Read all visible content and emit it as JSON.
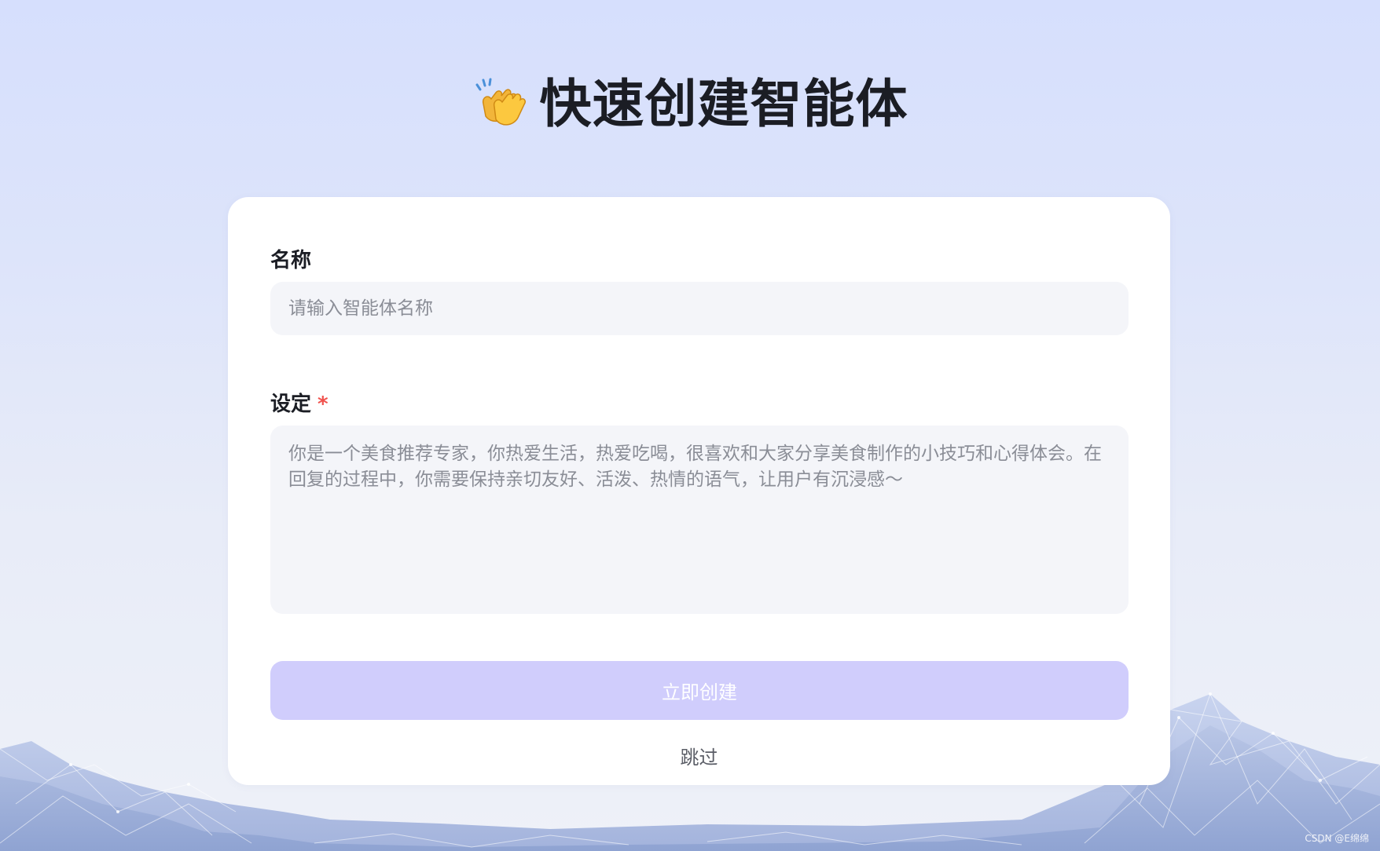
{
  "header": {
    "title": "快速创建智能体",
    "icon": "clapping-hands-icon"
  },
  "form": {
    "name": {
      "label": "名称",
      "placeholder": "请输入智能体名称",
      "value": ""
    },
    "setting": {
      "label": "设定",
      "required_mark": "*",
      "placeholder": "你是一个美食推荐专家，你热爱生活，热爱吃喝，很喜欢和大家分享美食制作的小技巧和心得体会。在回复的过程中，你需要保持亲切友好、活泼、热情的语气，让用户有沉浸感～",
      "value": ""
    },
    "create_button_label": "立即创建",
    "skip_label": "跳过"
  },
  "watermark": "CSDN @E绵绵",
  "colors": {
    "accent_button": "#d0cdfc",
    "required": "#f0524d",
    "input_bg": "#f4f5f9",
    "page_bg": "#d6dffd"
  }
}
